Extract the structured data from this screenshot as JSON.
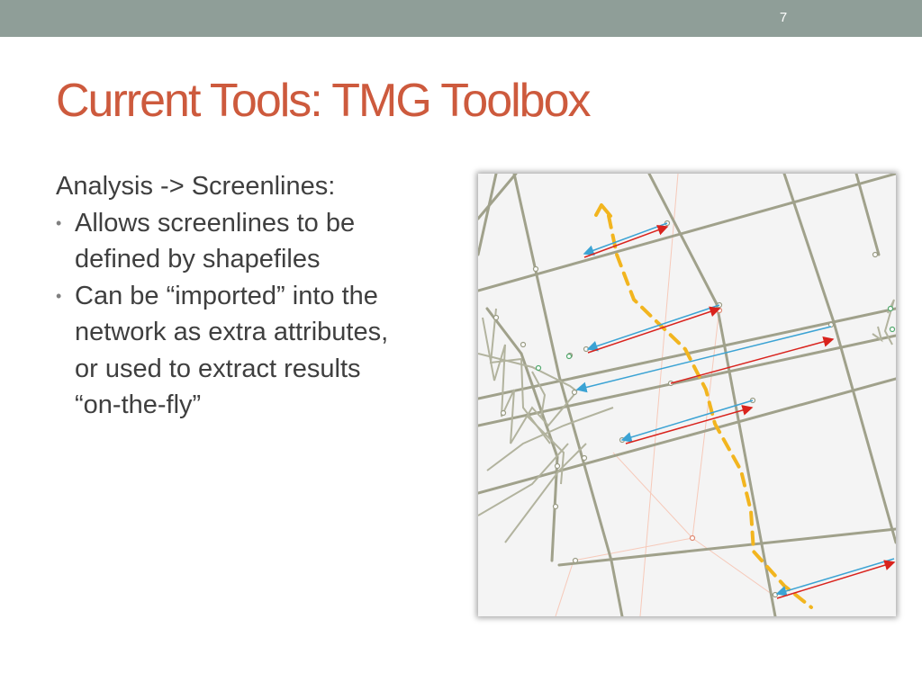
{
  "slide": {
    "number": "7",
    "title": "Current Tools: TMG Toolbox"
  },
  "content": {
    "subheading": "Analysis -> Screenlines:",
    "bullets": [
      {
        "lines": [
          "Allows screenlines to be",
          "defined by shapefiles"
        ]
      },
      {
        "lines": [
          "Can be “imported” into the",
          "network as extra attributes,",
          "or used to extract results",
          "“on-the-fly”"
        ]
      }
    ]
  },
  "map": {
    "colors": {
      "background": "#f4f4f4",
      "road": "#9a9a86",
      "faint_link": "#f4c4b4",
      "screenline": "#f2b51f",
      "direction_a": "#3ba3d4",
      "direction_b": "#d9231d"
    }
  }
}
